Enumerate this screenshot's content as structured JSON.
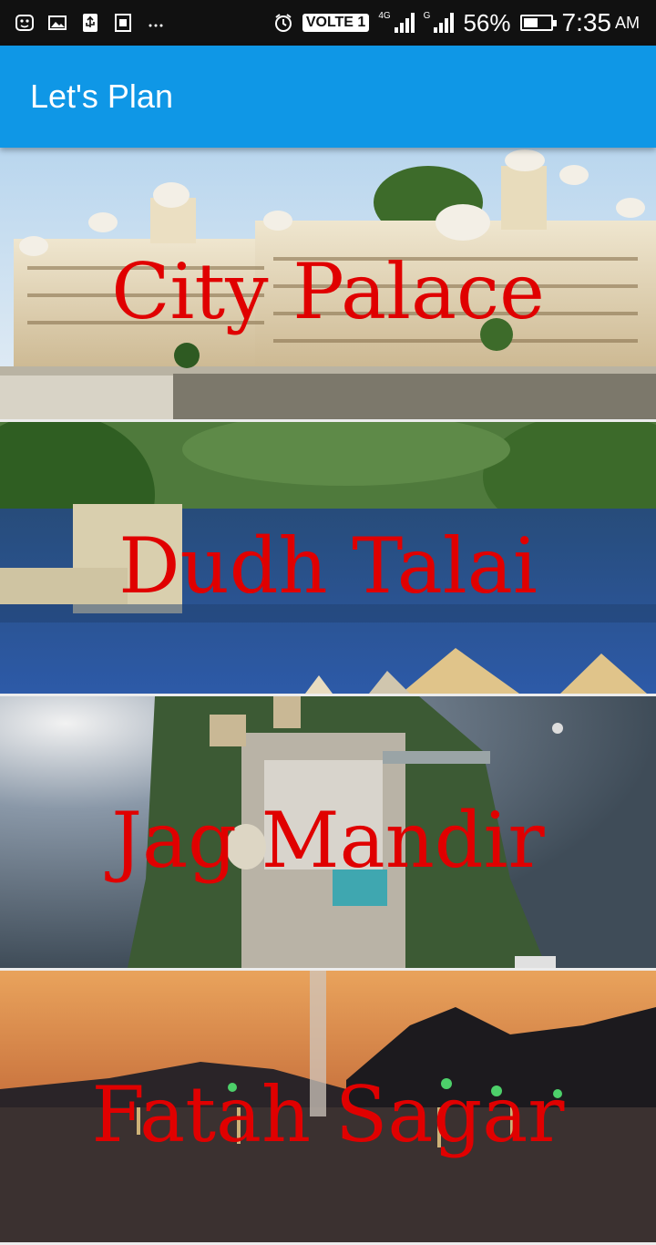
{
  "status_bar": {
    "volte": "VOLTE 1",
    "net1_label": "4G",
    "net2_label": "G",
    "battery_percent": "56%",
    "battery_level": 0.56,
    "time": "7:35",
    "ampm": "AM",
    "icons": [
      "face-notification-icon",
      "image-icon",
      "usb-icon",
      "usb-debug-icon",
      "more-icon",
      "alarm-icon"
    ]
  },
  "app_bar": {
    "title": "Let's Plan"
  },
  "places": [
    {
      "name": "City Palace"
    },
    {
      "name": "Dudh Talai"
    },
    {
      "name": "Jag Mandir"
    },
    {
      "name": "Fatah Sagar"
    }
  ]
}
